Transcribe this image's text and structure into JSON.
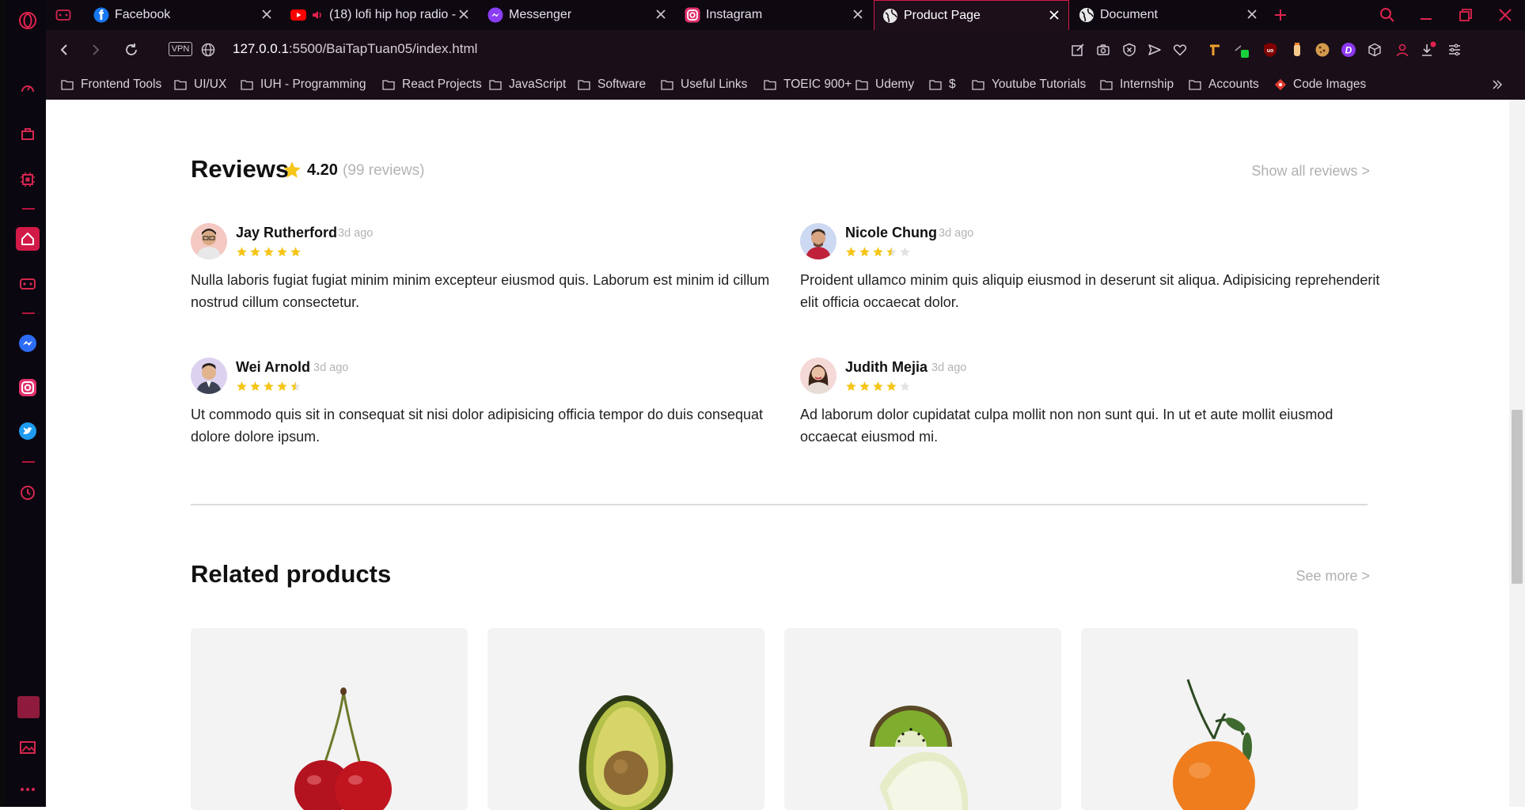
{
  "tabs": [
    {
      "title": "Facebook",
      "icon": "facebook-icon"
    },
    {
      "title": "(18) lofi hip hop radio -",
      "icon": "youtube-icon",
      "audio": true
    },
    {
      "title": "Messenger",
      "icon": "messenger-icon"
    },
    {
      "title": "Instagram",
      "icon": "instagram-icon"
    },
    {
      "title": "Product Page",
      "icon": "globe-icon",
      "active": true
    },
    {
      "title": "Document",
      "icon": "globe-icon"
    }
  ],
  "address": {
    "vpn_label": "VPN",
    "host": "127.0.0.1",
    "path": ":5500/BaiTapTuan05/index.html"
  },
  "bookmarks": [
    "Frontend Tools",
    "UI/UX",
    "IUH - Programming",
    "React Projects",
    "JavaScript",
    "Software",
    "Useful Links",
    "TOEIC 900+",
    "Udemy",
    "$",
    "Youtube Tutorials",
    "Internship",
    "Accounts",
    "Code Images"
  ],
  "reviews_section": {
    "title": "Reviews",
    "rating": "4.20",
    "count": "(99 reviews)",
    "show_all": "Show all reviews >",
    "accent_color": "#f5c518"
  },
  "reviews": [
    {
      "name": "Jay Rutherford",
      "time": "3d ago",
      "stars": 5,
      "text": "Nulla laboris fugiat fugiat minim minim excepteur eiusmod quis. Laborum est minim id cillum nostrud cillum consectetur."
    },
    {
      "name": "Nicole Chung",
      "time": "3d ago",
      "stars": 3.5,
      "text": "Proident ullamco minim quis aliquip eiusmod in deserunt sit aliqua. Adipisicing reprehenderit elit officia occaecat dolor."
    },
    {
      "name": "Wei Arnold",
      "time": "3d ago",
      "stars": 4.5,
      "text": "Ut commodo quis sit in consequat sit nisi dolor adipisicing officia tempor do duis consequat dolore dolore ipsum."
    },
    {
      "name": "Judith Mejia",
      "time": "3d ago",
      "stars": 4,
      "text": "Ad laborum dolor cupidatat culpa mollit non non sunt qui. In ut et aute mollit eiusmod occaecat eiusmod mi."
    }
  ],
  "related": {
    "title": "Related products",
    "see_more": "See more >",
    "products": [
      "cherry",
      "avocado",
      "kiwi-lime",
      "mandarin"
    ]
  }
}
